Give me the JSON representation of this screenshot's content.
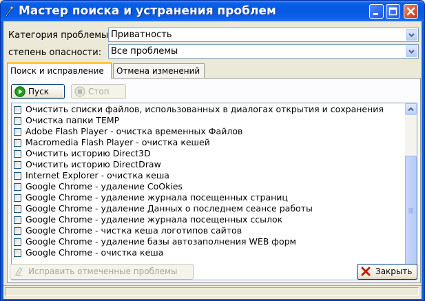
{
  "window": {
    "title": "Мастер поиска и устранения проблем"
  },
  "filters": {
    "category_label": "Категория проблемы:",
    "category_value": "Приватность",
    "severity_label": "степень опасности:",
    "severity_value": "Все проблемы"
  },
  "tabs": [
    {
      "label": "Поиск и исправление",
      "active": true
    },
    {
      "label": "Отмена изменений",
      "active": false
    }
  ],
  "toolbar": {
    "start_label": "Пуск",
    "stop_label": "Стоп"
  },
  "items": [
    {
      "label": "Очистить списки файлов, использованных в диалогах открытия и сохранения",
      "checked": false
    },
    {
      "label": "Очистка папки TEMP",
      "checked": false
    },
    {
      "label": "Adobe Flash Player - очистка временных Файлов",
      "checked": false
    },
    {
      "label": "Macromedia Flash Player - очистка кешей",
      "checked": false
    },
    {
      "label": "Очистить историю Direct3D",
      "checked": false
    },
    {
      "label": "Очистить историю DirectDraw",
      "checked": false
    },
    {
      "label": "Internet Explorer - очистка кеша",
      "checked": false
    },
    {
      "label": "Google Chrome - удаление CoOkies",
      "checked": false
    },
    {
      "label": "Google Chrome - удаление журнала посещенных страниц",
      "checked": false
    },
    {
      "label": "Google Chrome - удаление Данных о последнем сеансе работы",
      "checked": false
    },
    {
      "label": "Google Chrome - удаление журнала посещенных ссылок",
      "checked": false
    },
    {
      "label": "Google Chrome - чистка кеша логотипов сайтов",
      "checked": false
    },
    {
      "label": "Google Chrome - удаление базы автозаполнения WEB форм",
      "checked": false
    },
    {
      "label": "Google Chrome - очистка кеша",
      "checked": false
    }
  ],
  "footer": {
    "fix_label": "Исправить отмеченные проблемы",
    "close_label": "Закрыть"
  }
}
